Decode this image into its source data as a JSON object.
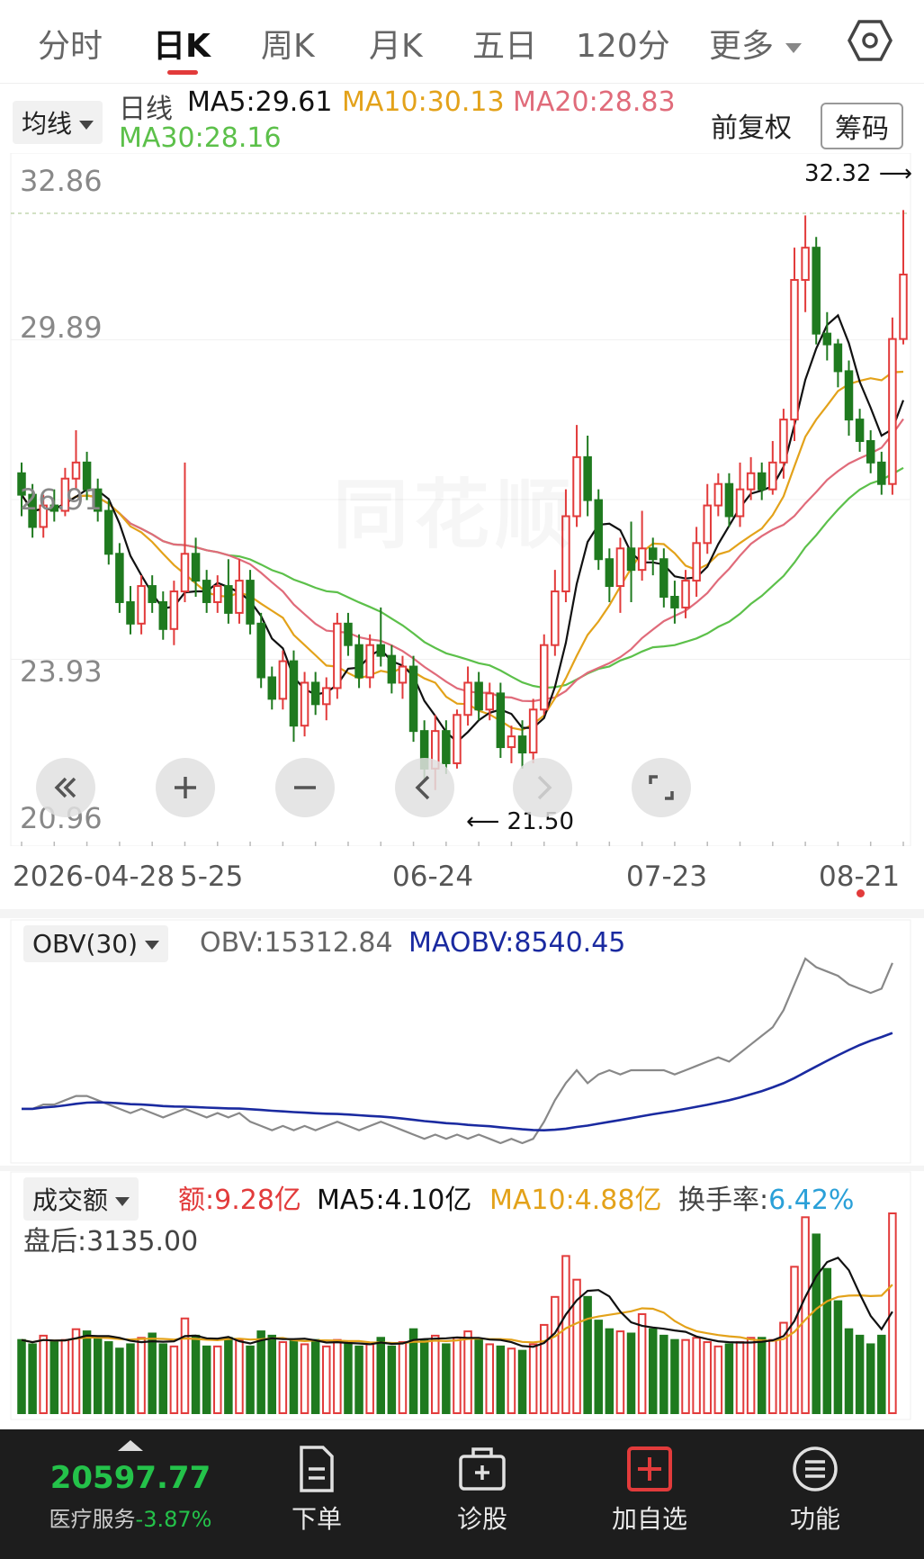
{
  "tabs": [
    {
      "label": "分时",
      "active": false
    },
    {
      "label": "日K",
      "active": true
    },
    {
      "label": "周K",
      "active": false
    },
    {
      "label": "月K",
      "active": false
    },
    {
      "label": "五日",
      "active": false
    },
    {
      "label": "120分",
      "active": false
    },
    {
      "label": "更多",
      "active": false,
      "dropdown": true
    }
  ],
  "settings_icon": "hexagon-gear-icon",
  "main_chart": {
    "indicator_select": "均线",
    "period_label": "日线",
    "ma_labels": {
      "ma5": "MA5:29.61",
      "ma10": "MA10:30.13",
      "ma20": "MA20:28.83",
      "ma30": "MA30:28.16"
    },
    "adjust_label": "前复权",
    "chip_button": "筹码",
    "y_ticks": [
      "32.86",
      "29.89",
      "26.91",
      "23.93",
      "20.96"
    ],
    "high_annotation": "32.32",
    "low_annotation": "21.50",
    "dates": [
      "2026-04-28",
      "5-25",
      "06-24",
      "07-23",
      "08-21"
    ],
    "watermark": "同花顺"
  },
  "obv_panel": {
    "select": "OBV(30)",
    "obv": "OBV:15312.84",
    "maobv": "MAOBV:8540.45"
  },
  "volume_panel": {
    "select": "成交额",
    "amount": "额:9.28亿",
    "ma5": "MA5:4.10亿",
    "ma10": "MA10:4.88亿",
    "turnover_label": "换手率:",
    "turnover_value": "6.42%",
    "after_hours": "盘后:3135.00"
  },
  "zoom_controls": [
    "fast-rewind-icon",
    "zoom-in-icon",
    "zoom-out-icon",
    "prev-icon",
    "next-icon",
    "fullscreen-icon"
  ],
  "bottom_bar": {
    "index_value": "20597.77",
    "index_name": "医疗服务",
    "index_change": "-3.87%",
    "items": [
      {
        "label": "下单",
        "icon": "order-document-icon"
      },
      {
        "label": "诊股",
        "icon": "medical-kit-icon"
      },
      {
        "label": "加自选",
        "icon": "add-favorite-icon"
      },
      {
        "label": "功能",
        "icon": "menu-circle-icon"
      }
    ]
  },
  "colors": {
    "up": "#e23b3b",
    "down": "#1f7a1f",
    "ma5": "#111111",
    "ma10": "#e3a21a",
    "ma20": "#e06b7a",
    "ma30": "#5cc04a",
    "maobv": "#1a2aa0",
    "turnover": "#2aa0d8",
    "index_up": "#24c24a"
  },
  "chart_data": {
    "type": "candlestick",
    "y_range": [
      20.96,
      32.86
    ],
    "high": 32.32,
    "low": 21.5,
    "candles": [
      [
        27.4,
        27.0,
        27.6,
        26.6
      ],
      [
        27.0,
        26.4,
        27.2,
        26.2
      ],
      [
        26.4,
        26.8,
        27.0,
        26.2
      ],
      [
        26.8,
        26.7,
        27.1,
        26.5
      ],
      [
        26.7,
        27.3,
        27.5,
        26.6
      ],
      [
        27.3,
        27.6,
        28.2,
        27.1
      ],
      [
        27.6,
        27.1,
        27.8,
        26.9
      ],
      [
        27.1,
        26.7,
        27.3,
        26.5
      ],
      [
        26.7,
        25.9,
        26.9,
        25.7
      ],
      [
        25.9,
        25.0,
        26.1,
        24.8
      ],
      [
        25.0,
        24.6,
        25.3,
        24.4
      ],
      [
        24.6,
        25.3,
        25.5,
        24.4
      ],
      [
        25.3,
        25.0,
        25.5,
        24.8
      ],
      [
        25.0,
        24.5,
        25.2,
        24.3
      ],
      [
        24.5,
        25.2,
        25.4,
        24.2
      ],
      [
        25.2,
        25.9,
        27.6,
        25.0
      ],
      [
        25.9,
        25.4,
        26.2,
        25.1
      ],
      [
        25.4,
        25.0,
        25.6,
        24.8
      ],
      [
        25.0,
        25.3,
        25.5,
        24.8
      ],
      [
        25.3,
        24.8,
        25.8,
        24.6
      ],
      [
        24.8,
        25.4,
        25.8,
        24.6
      ],
      [
        25.4,
        24.6,
        25.6,
        24.4
      ],
      [
        24.6,
        23.6,
        24.8,
        23.4
      ],
      [
        23.6,
        23.2,
        23.8,
        23.0
      ],
      [
        23.2,
        23.9,
        24.1,
        23.0
      ],
      [
        23.9,
        22.7,
        24.1,
        22.4
      ],
      [
        22.7,
        23.5,
        23.7,
        22.5
      ],
      [
        23.5,
        23.1,
        23.7,
        22.9
      ],
      [
        23.1,
        23.4,
        23.6,
        22.8
      ],
      [
        23.4,
        24.6,
        24.8,
        23.2
      ],
      [
        24.6,
        24.2,
        24.8,
        24.0
      ],
      [
        24.2,
        23.6,
        24.4,
        23.4
      ],
      [
        23.6,
        24.2,
        24.4,
        23.4
      ],
      [
        24.2,
        24.0,
        24.9,
        23.8
      ],
      [
        24.0,
        23.5,
        24.2,
        23.3
      ],
      [
        23.5,
        23.8,
        24.0,
        23.2
      ],
      [
        23.8,
        22.6,
        24.0,
        22.4
      ],
      [
        22.6,
        21.9,
        22.8,
        21.7
      ],
      [
        21.9,
        22.6,
        22.9,
        21.5
      ],
      [
        22.6,
        22.0,
        22.8,
        21.8
      ],
      [
        22.0,
        22.9,
        23.0,
        21.9
      ],
      [
        22.9,
        23.5,
        23.8,
        22.7
      ],
      [
        23.5,
        23.0,
        23.7,
        22.8
      ],
      [
        23.0,
        23.3,
        23.5,
        22.8
      ],
      [
        23.3,
        22.3,
        23.5,
        22.1
      ],
      [
        22.3,
        22.5,
        22.7,
        22.0
      ],
      [
        22.5,
        22.2,
        22.8,
        21.9
      ],
      [
        22.2,
        23.0,
        23.2,
        22.0
      ],
      [
        23.0,
        24.2,
        24.4,
        22.9
      ],
      [
        24.2,
        25.2,
        25.6,
        24.0
      ],
      [
        25.2,
        26.6,
        27.1,
        25.0
      ],
      [
        26.6,
        27.7,
        28.3,
        26.4
      ],
      [
        27.7,
        26.9,
        28.1,
        26.6
      ],
      [
        26.9,
        25.8,
        27.1,
        25.6
      ],
      [
        25.8,
        25.3,
        26.0,
        25.0
      ],
      [
        25.3,
        26.0,
        26.2,
        24.8
      ],
      [
        26.0,
        25.6,
        26.5,
        25.0
      ],
      [
        25.6,
        26.0,
        26.7,
        25.4
      ],
      [
        26.0,
        25.8,
        26.2,
        25.5
      ],
      [
        25.8,
        25.1,
        26.0,
        24.9
      ],
      [
        25.1,
        24.9,
        25.4,
        24.6
      ],
      [
        24.9,
        25.4,
        25.6,
        24.7
      ],
      [
        25.4,
        26.1,
        26.4,
        25.1
      ],
      [
        26.1,
        26.8,
        27.2,
        25.9
      ],
      [
        26.8,
        27.2,
        27.4,
        26.6
      ],
      [
        27.2,
        26.6,
        27.4,
        26.4
      ],
      [
        26.6,
        27.1,
        27.6,
        26.4
      ],
      [
        27.1,
        27.4,
        27.7,
        26.9
      ],
      [
        27.4,
        27.1,
        27.6,
        26.9
      ],
      [
        27.1,
        27.6,
        28.0,
        27.0
      ],
      [
        27.6,
        28.4,
        28.6,
        27.3
      ],
      [
        28.4,
        31.0,
        31.6,
        28.0
      ],
      [
        31.0,
        31.6,
        32.2,
        30.4
      ],
      [
        31.6,
        30.0,
        31.8,
        29.8
      ],
      [
        30.0,
        29.8,
        30.4,
        29.5
      ],
      [
        29.8,
        29.3,
        29.9,
        29.0
      ],
      [
        29.3,
        28.4,
        29.5,
        28.1
      ],
      [
        28.4,
        28.0,
        28.6,
        27.8
      ],
      [
        28.0,
        27.6,
        28.2,
        27.4
      ],
      [
        27.6,
        27.2,
        27.8,
        27.0
      ],
      [
        27.2,
        29.9,
        30.3,
        27.0
      ],
      [
        29.9,
        31.1,
        32.3,
        29.8
      ]
    ],
    "obv": [
      0.0,
      0.0,
      0.1,
      0.1,
      0.2,
      0.3,
      0.3,
      0.2,
      0.1,
      0.0,
      -0.1,
      0.0,
      -0.1,
      -0.2,
      -0.1,
      0.0,
      -0.1,
      -0.2,
      -0.1,
      -0.2,
      -0.1,
      -0.3,
      -0.4,
      -0.5,
      -0.4,
      -0.5,
      -0.4,
      -0.5,
      -0.4,
      -0.3,
      -0.4,
      -0.5,
      -0.4,
      -0.3,
      -0.4,
      -0.5,
      -0.6,
      -0.7,
      -0.6,
      -0.7,
      -0.6,
      -0.7,
      -0.6,
      -0.7,
      -0.8,
      -0.7,
      -0.8,
      -0.7,
      -0.3,
      0.2,
      0.6,
      0.9,
      0.6,
      0.8,
      0.9,
      0.8,
      0.9,
      0.9,
      0.9,
      0.9,
      0.8,
      0.9,
      1.0,
      1.1,
      1.2,
      1.1,
      1.3,
      1.5,
      1.7,
      1.9,
      2.3,
      2.9,
      3.5,
      3.3,
      3.2,
      3.1,
      2.9,
      2.8,
      2.7,
      2.8,
      3.4
    ],
    "volume": [
      3.4,
      3.2,
      3.6,
      3.3,
      3.4,
      3.9,
      3.8,
      3.5,
      3.3,
      3.0,
      3.2,
      3.5,
      3.7,
      3.2,
      3.1,
      4.4,
      3.6,
      3.1,
      3.1,
      3.5,
      3.4,
      3.1,
      3.8,
      3.6,
      3.3,
      3.4,
      3.2,
      3.4,
      3.1,
      3.4,
      3.2,
      3.1,
      3.2,
      3.5,
      3.1,
      3.3,
      3.9,
      3.4,
      3.6,
      3.2,
      3.5,
      3.8,
      3.4,
      3.2,
      3.1,
      3.0,
      2.9,
      3.2,
      4.1,
      5.4,
      7.3,
      6.2,
      5.4,
      4.3,
      3.9,
      3.8,
      3.7,
      4.6,
      3.9,
      3.6,
      3.4,
      3.4,
      3.5,
      3.3,
      3.1,
      3.2,
      3.3,
      3.5,
      3.5,
      3.4,
      4.2,
      6.8,
      9.1,
      8.3,
      6.7,
      5.2,
      3.9,
      3.6,
      3.2,
      3.6,
      9.28
    ]
  }
}
